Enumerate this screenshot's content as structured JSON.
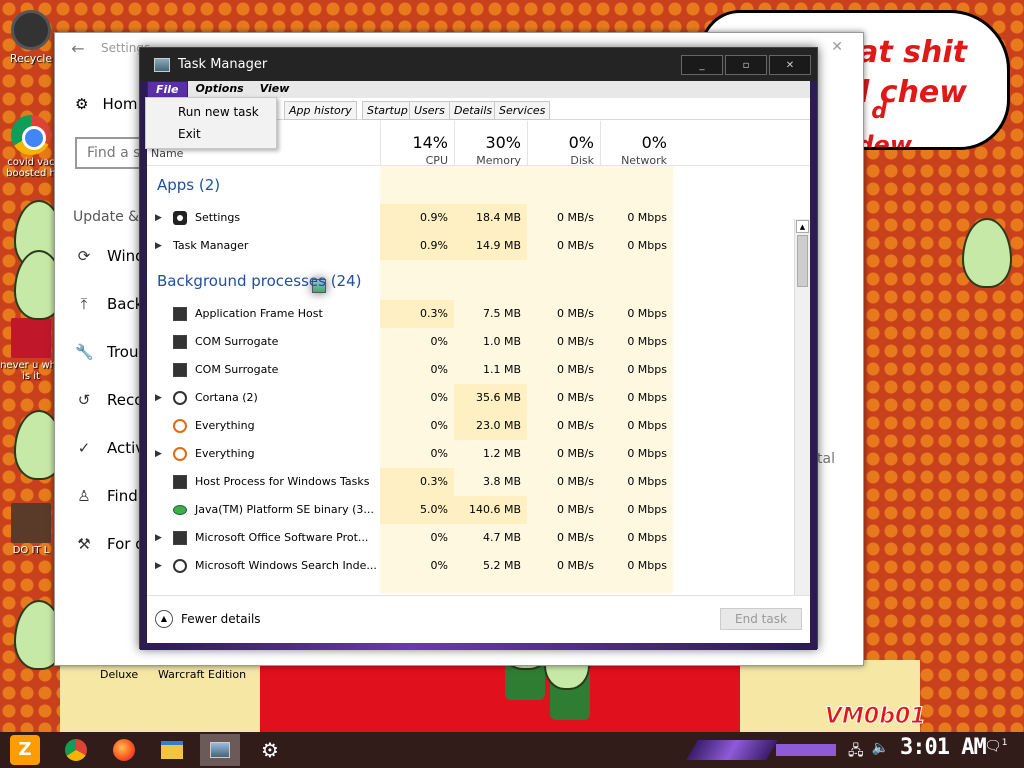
{
  "desktop": {
    "icons": [
      {
        "label": "Recycle"
      },
      {
        "label": "covid vac boosted h"
      },
      {
        "label": "never u why is it"
      },
      {
        "label": "DO IT L"
      }
    ],
    "speech_lines": [
      "eat shit",
      "d chew",
      "d",
      "dew"
    ],
    "captions": [
      "Deluxe",
      "Warcraft Edition"
    ],
    "watermark": "VM0b01"
  },
  "settings": {
    "title": "Settings",
    "home": "Hom",
    "search_placeholder": "Find a s",
    "section": "Update &",
    "nav": [
      {
        "icon": "refresh-icon",
        "label": "Wind"
      },
      {
        "icon": "backup-icon",
        "label": "Back"
      },
      {
        "icon": "wrench-icon",
        "label": "Troub"
      },
      {
        "icon": "recovery-icon",
        "label": "Reco"
      },
      {
        "icon": "activation-icon",
        "label": "Activ"
      },
      {
        "icon": "find-device-icon",
        "label": "Find"
      },
      {
        "icon": "developer-icon",
        "label": "For d"
      }
    ],
    "right_fragment": "tal"
  },
  "taskmanager": {
    "title": "Task Manager",
    "menu": [
      "File",
      "Options",
      "View"
    ],
    "file_menu": [
      "Run new task",
      "Exit"
    ],
    "tabs": [
      "App history",
      "Startup",
      "Users",
      "Details",
      "Services"
    ],
    "header": {
      "name": "Name",
      "cpu_pct": "14%",
      "cpu": "CPU",
      "mem_pct": "30%",
      "mem": "Memory",
      "disk_pct": "0%",
      "disk": "Disk",
      "net_pct": "0%",
      "net": "Network"
    },
    "apps_group": "Apps (2)",
    "apps": [
      {
        "name": "Settings",
        "icon": "gear-icon",
        "cpu": "0.9%",
        "mem": "18.4 MB",
        "disk": "0 MB/s",
        "net": "0 Mbps"
      },
      {
        "name": "Task Manager",
        "icon": "taskmanager-icon",
        "cpu": "0.9%",
        "mem": "14.9 MB",
        "disk": "0 MB/s",
        "net": "0 Mbps"
      }
    ],
    "bg_group": "Background processes (24)",
    "bg": [
      {
        "name": "Application Frame Host",
        "icon": "window-icon",
        "cpu": "0.3%",
        "mem": "7.5 MB",
        "disk": "0 MB/s",
        "net": "0 Mbps"
      },
      {
        "name": "COM Surrogate",
        "icon": "window-icon",
        "cpu": "0%",
        "mem": "1.0 MB",
        "disk": "0 MB/s",
        "net": "0 Mbps"
      },
      {
        "name": "COM Surrogate",
        "icon": "window-icon",
        "cpu": "0%",
        "mem": "1.1 MB",
        "disk": "0 MB/s",
        "net": "0 Mbps"
      },
      {
        "name": "Cortana (2)",
        "icon": "cortana-icon",
        "cpu": "0%",
        "mem": "35.6 MB",
        "disk": "0 MB/s",
        "net": "0 Mbps"
      },
      {
        "name": "Everything",
        "icon": "search-icon",
        "cpu": "0%",
        "mem": "23.0 MB",
        "disk": "0 MB/s",
        "net": "0 Mbps"
      },
      {
        "name": "Everything",
        "icon": "search-icon",
        "cpu": "0%",
        "mem": "1.2 MB",
        "disk": "0 MB/s",
        "net": "0 Mbps"
      },
      {
        "name": "Host Process for Windows Tasks",
        "icon": "window-icon",
        "cpu": "0.3%",
        "mem": "3.8 MB",
        "disk": "0 MB/s",
        "net": "0 Mbps"
      },
      {
        "name": "Java(TM) Platform SE binary (3...",
        "icon": "java-icon",
        "cpu": "5.0%",
        "mem": "140.6 MB",
        "disk": "0 MB/s",
        "net": "0 Mbps"
      },
      {
        "name": "Microsoft Office Software Prot...",
        "icon": "window-icon",
        "cpu": "0%",
        "mem": "4.7 MB",
        "disk": "0 MB/s",
        "net": "0 Mbps"
      },
      {
        "name": "Microsoft Windows Search Inde...",
        "icon": "search-indexer-icon",
        "cpu": "0%",
        "mem": "5.2 MB",
        "disk": "0 MB/s",
        "net": "0 Mbps"
      }
    ],
    "fewer_details": "Fewer details",
    "end_task": "End task"
  },
  "taskbar": {
    "start_label": "Z",
    "clock": "3:01 AM",
    "notif_count": "1"
  }
}
